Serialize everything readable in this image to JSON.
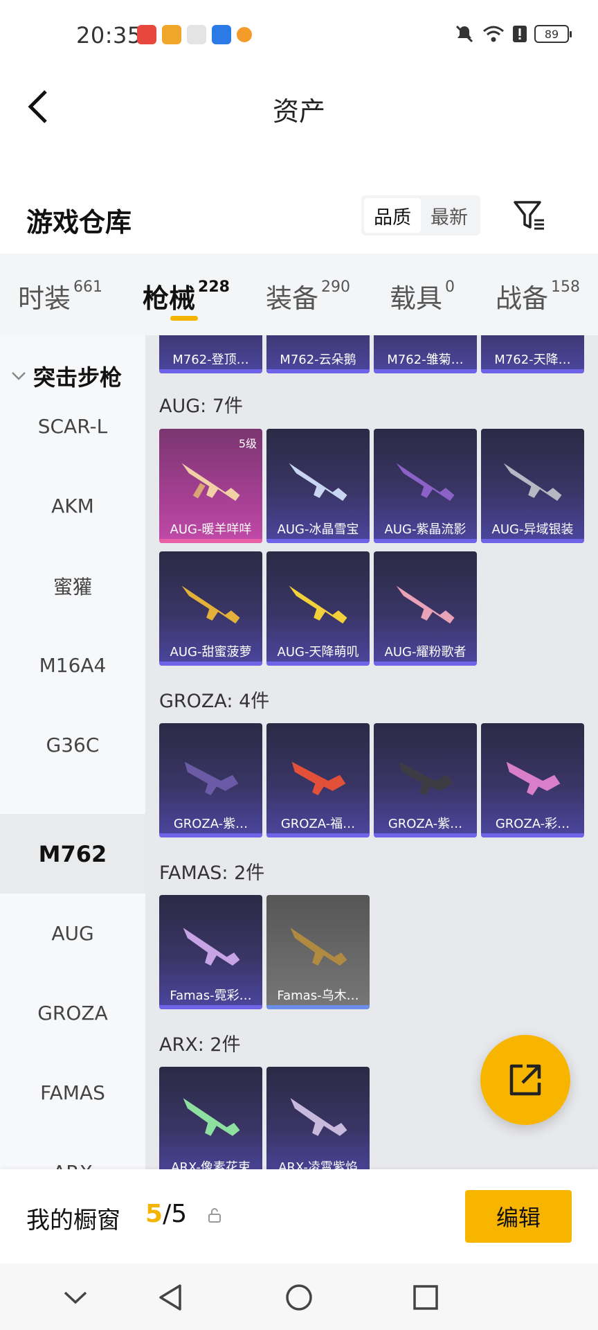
{
  "status_bar": {
    "time": "20:35",
    "battery": "89",
    "app_icon_colors": [
      "#e8473d",
      "#f0a62a",
      "#e4e4e4",
      "#2b7ae6",
      "#f49b2a"
    ]
  },
  "header": {
    "title": "资产",
    "back_icon": "back-arrow-icon"
  },
  "section": {
    "title": "游戏仓库",
    "sort_options": [
      "品质",
      "最新"
    ],
    "sort_active": "品质",
    "filter_icon": "filter-icon"
  },
  "tabs": [
    {
      "label": "时装",
      "count": "661"
    },
    {
      "label": "枪械",
      "count": "228"
    },
    {
      "label": "装备",
      "count": "290"
    },
    {
      "label": "载具",
      "count": "0"
    },
    {
      "label": "战备",
      "count": "158"
    }
  ],
  "active_tab": "枪械",
  "sidebar": {
    "group": "突击步枪",
    "items": [
      "SCAR-L",
      "AKM",
      "蜜獾",
      "M16A4",
      "G36C",
      "M762",
      "AUG",
      "GROZA",
      "FAMAS",
      "ARX"
    ],
    "active": "M762"
  },
  "content": {
    "top_row": [
      "M762-登顶…",
      "M762-云朵鹅",
      "M762-雏菊…",
      "M762-天降…"
    ],
    "groups": [
      {
        "label": "AUG: 7件",
        "items": [
          {
            "name": "AUG-暖羊咩咩",
            "level": "5级",
            "style": "pink"
          },
          {
            "name": "AUG-冰晶雪宝"
          },
          {
            "name": "AUG-紫晶流影"
          },
          {
            "name": "AUG-异域银装"
          },
          {
            "name": "AUG-甜蜜菠萝"
          },
          {
            "name": "AUG-天降萌叽"
          },
          {
            "name": "AUG-耀粉歌者"
          }
        ]
      },
      {
        "label": "GROZA: 4件",
        "items": [
          {
            "name": "GROZA-紫…"
          },
          {
            "name": "GROZA-福…"
          },
          {
            "name": "GROZA-紫…"
          },
          {
            "name": "GROZA-彩…"
          }
        ]
      },
      {
        "label": "FAMAS: 2件",
        "items": [
          {
            "name": "Famas-霓彩…"
          },
          {
            "name": "Famas-乌木…",
            "style": "gray"
          }
        ]
      },
      {
        "label": "ARX: 2件",
        "items": [
          {
            "name": "ARX-像素花束"
          },
          {
            "name": "ARX-凌霄紫焰"
          }
        ]
      }
    ]
  },
  "fab": {
    "icon": "share-external-icon"
  },
  "bottom_bar": {
    "label": "我的橱窗",
    "count_current": "5",
    "count_total": "/5",
    "lock_icon": "lock-icon",
    "edit_label": "编辑"
  },
  "navbar": [
    "chevron-down-icon",
    "back-triangle-icon",
    "home-circle-icon",
    "recents-square-icon"
  ]
}
